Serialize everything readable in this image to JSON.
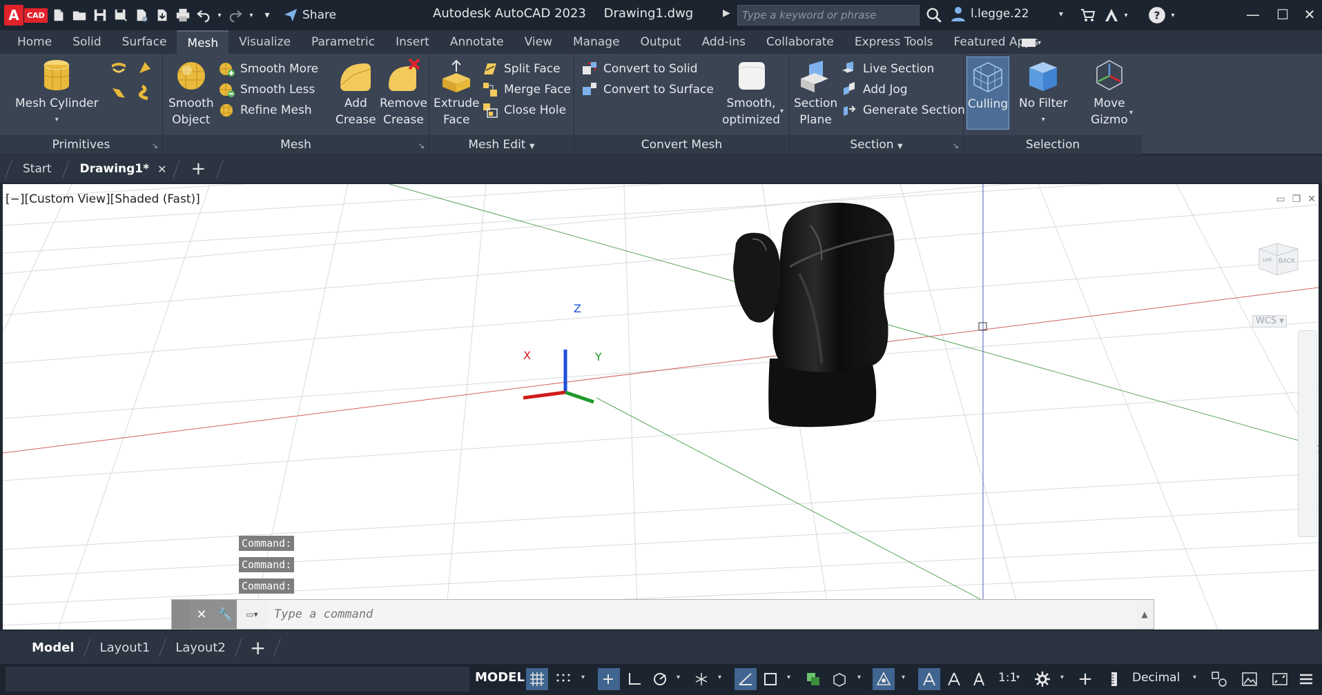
{
  "app": {
    "logo_letter": "A",
    "logo_suffix": "CAD",
    "title_app": "Autodesk AutoCAD 2023",
    "title_file": "Drawing1.dwg",
    "share_label": "Share",
    "search_placeholder": "Type a keyword or phrase",
    "username": "l.legge.22"
  },
  "ribbon_tabs": [
    "Home",
    "Solid",
    "Surface",
    "Mesh",
    "Visualize",
    "Parametric",
    "Insert",
    "Annotate",
    "View",
    "Manage",
    "Output",
    "Add-ins",
    "Collaborate",
    "Express Tools",
    "Featured Apps"
  ],
  "active_ribbon_tab": "Mesh",
  "panels": {
    "primitives": {
      "title": "Primitives",
      "mesh_cylinder": "Mesh Cylinder"
    },
    "mesh": {
      "title": "Mesh",
      "smooth_object_1": "Smooth",
      "smooth_object_2": "Object",
      "smooth_more": "Smooth More",
      "smooth_less": "Smooth Less",
      "refine_mesh": "Refine Mesh",
      "add_crease_1": "Add",
      "add_crease_2": "Crease",
      "remove_crease_1": "Remove",
      "remove_crease_2": "Crease"
    },
    "mesh_edit": {
      "title": "Mesh Edit",
      "extrude_face_1": "Extrude",
      "extrude_face_2": "Face",
      "split_face": "Split Face",
      "merge_face": "Merge Face",
      "close_hole": "Close Hole"
    },
    "convert_mesh": {
      "title": "Convert Mesh",
      "convert_to_solid": "Convert to Solid",
      "convert_to_surface": "Convert to Surface",
      "smooth_optimized_1": "Smooth,",
      "smooth_optimized_2": "optimized"
    },
    "section": {
      "title": "Section",
      "section_plane_1": "Section",
      "section_plane_2": "Plane",
      "live_section": "Live Section",
      "add_jog": "Add Jog",
      "generate_section": "Generate Section"
    },
    "selection": {
      "title": "Selection",
      "culling": "Culling",
      "no_filter": "No Filter",
      "move_gizmo_1": "Move",
      "move_gizmo_2": "Gizmo"
    }
  },
  "doc_tabs": {
    "start": "Start",
    "drawing": "Drawing1*"
  },
  "viewport": {
    "label": "[−][Custom View][Shaded (Fast)]",
    "viewcube_face": "BACK",
    "viewcube_side": "Left",
    "wcs": "WCS",
    "axis_x": "X",
    "axis_y": "Y",
    "axis_z": "Z"
  },
  "command": {
    "history": [
      "Command:",
      "Command:",
      "Command:"
    ],
    "placeholder": "Type a command"
  },
  "layout_tabs": [
    "Model",
    "Layout1",
    "Layout2"
  ],
  "status": {
    "model": "MODEL",
    "scale": "1:1",
    "units": "Decimal"
  },
  "colors": {
    "accent_blue": "#4c6e96",
    "axis_red": "#d01c1c",
    "axis_green": "#1e9a2a",
    "axis_blue": "#1e4fd8"
  }
}
